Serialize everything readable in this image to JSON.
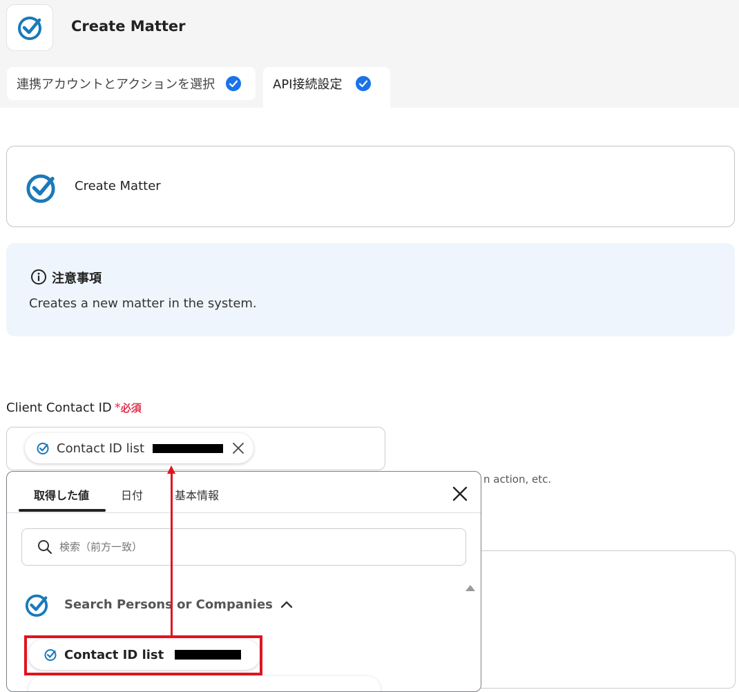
{
  "header": {
    "title": "Create Matter"
  },
  "tabs": [
    {
      "label": "連携アカウントとアクションを選択"
    },
    {
      "label": "API接続設定"
    }
  ],
  "action_card": {
    "label": "Create Matter"
  },
  "notice": {
    "title": "注意事項",
    "body": "Creates a new matter in the system."
  },
  "field": {
    "label": "Client Contact ID",
    "required_mark": "*",
    "required_text": "必須",
    "chip_label": "Contact ID list",
    "helper_fragment": "n action, etc."
  },
  "dropdown": {
    "tabs": [
      "取得した値",
      "日付",
      "基本情報"
    ],
    "search_placeholder": "検索（前方一致）",
    "group_label": "Search Persons or Companies",
    "item_label": "Contact ID list"
  },
  "colors": {
    "accent": "#1a73e8",
    "brand": "#1b79b9",
    "required": "#e0334f",
    "highlight": "#e0141e"
  }
}
